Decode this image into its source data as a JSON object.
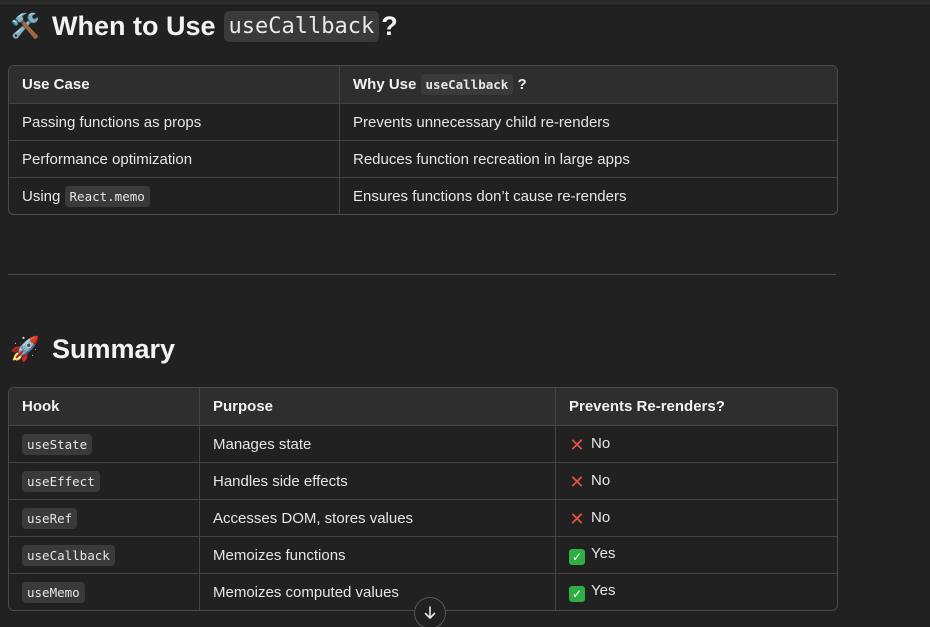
{
  "section1": {
    "emoji": "🛠️",
    "title_prefix": "When to Use",
    "title_code": "useCallback",
    "title_suffix": "?",
    "table": {
      "headers": {
        "col1": "Use Case",
        "col2_prefix": "Why Use",
        "col2_code": "useCallback",
        "col2_suffix": "?"
      },
      "rows": [
        {
          "use_case": "Passing functions as props",
          "why": "Prevents unnecessary child re-renders"
        },
        {
          "use_case": "Performance optimization",
          "why": "Reduces function recreation in large apps"
        },
        {
          "use_case_prefix": "Using",
          "use_case_code": "React.memo",
          "why": "Ensures functions don’t cause re-renders"
        }
      ]
    }
  },
  "section2": {
    "emoji": "🚀",
    "title": "Summary",
    "table": {
      "headers": [
        "Hook",
        "Purpose",
        "Prevents Re-renders?"
      ],
      "rows": [
        {
          "hook": "useState",
          "purpose": "Manages state",
          "prevents": "No",
          "prevents_icon": "cross-mark-icon"
        },
        {
          "hook": "useEffect",
          "purpose": "Handles side effects",
          "prevents": "No",
          "prevents_icon": "cross-mark-icon"
        },
        {
          "hook": "useRef",
          "purpose": "Accesses DOM, stores values",
          "prevents": "No",
          "prevents_icon": "cross-mark-icon"
        },
        {
          "hook": "useCallback",
          "purpose": "Memoizes functions",
          "prevents": "Yes",
          "prevents_icon": "check-mark-icon"
        },
        {
          "hook": "useMemo",
          "purpose": "Memoizes computed values",
          "prevents": "Yes",
          "prevents_icon": "check-mark-icon"
        }
      ]
    }
  },
  "scroll_button": {
    "icon": "arrow-down-icon"
  },
  "colors": {
    "background": "#212121",
    "no_mark": "#e5533c",
    "yes_mark": "#2fae43"
  }
}
